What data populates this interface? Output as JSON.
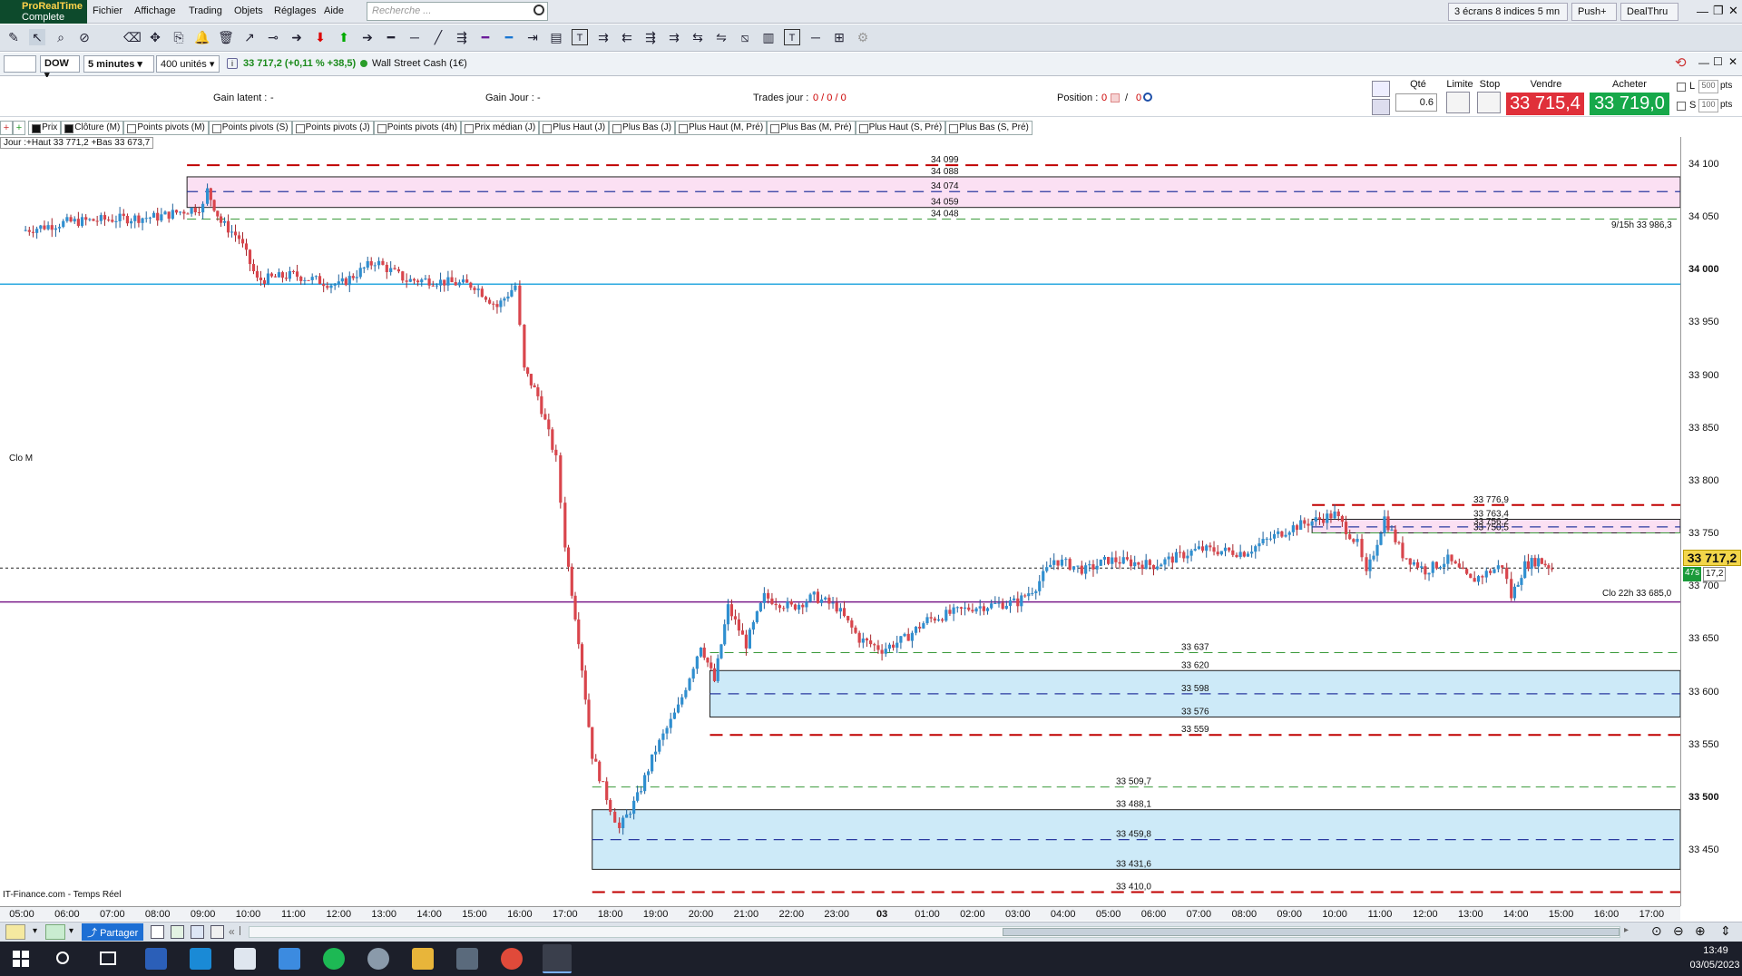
{
  "app": {
    "brand_line1": "ProRealTime",
    "brand_line2": "Complete"
  },
  "menu": [
    "Fichier",
    "Affichage",
    "Trading",
    "Objets",
    "Réglages",
    "Aide"
  ],
  "search": {
    "placeholder": "Recherche ..."
  },
  "topright": {
    "layout": "3 écrans 8 indices 5 mn",
    "push": "Push+",
    "dealthru": "DealThru"
  },
  "symbol": {
    "ticker": "DOW",
    "timeframe": "5 minutes",
    "units": "400 unités",
    "price_change": "33 717,2 (+0,11 % +38,5)",
    "name": "Wall Street Cash (1€)"
  },
  "info": {
    "gain_latent": "Gain latent :",
    "gain_latent_val": "-",
    "gain_jour": "Gain Jour :",
    "gain_jour_val": "-",
    "trades_jour": "Trades jour :",
    "trades_jour_val": "0 / 0 / 0",
    "position": "Position :",
    "position_val": "0",
    "position_val2": "0"
  },
  "order": {
    "qte_label": "Qté",
    "qte_value": "0.6",
    "limite": "Limite",
    "stop": "Stop",
    "vendre": "Vendre",
    "acheter": "Acheter",
    "sell_price": "33 715,4",
    "buy_price": "33 719,0",
    "l_label": "L",
    "l_val": "500",
    "s_label": "S",
    "s_val": "100",
    "pts": "pts"
  },
  "indicator_tabs": [
    "Prix",
    "Clôture (M)",
    "Points pivots (M)",
    "Points pivots (S)",
    "Points pivots (J)",
    "Points pivots (4h)",
    "Prix médian (J)",
    "Plus Haut (J)",
    "Plus Bas (J)",
    "Plus Haut (M, Pré)",
    "Plus Bas (M, Pré)",
    "Plus Haut (S, Pré)",
    "Plus Bas (S, Pré)"
  ],
  "jour_label": "Jour :+Haut 33 771,2 +Bas 33 673,7",
  "source_label": "IT-Finance.com - Temps Réel",
  "clo_m_label": "Clo M",
  "line_9_15": "9/15h 33 986,3",
  "line_clo22": "Clo 22h 33 685,0",
  "current_price": "33 717,2",
  "countdown": "47s",
  "spread_val": "17,2",
  "colors": {
    "bull": "#2f8fd0",
    "bear": "#d9454c",
    "red_dash": "#c00000",
    "green_dash": "#3a9a3a",
    "pink_zone": "#fbe0f3",
    "blue_zone": "#cdeaf8",
    "cyan": "#2aa8e0",
    "purple": "#7a1c8a"
  },
  "chart_data": {
    "type": "candlestick",
    "instrument": "DOW",
    "timeframe": "5 minutes",
    "xaxis_ticks": [
      "05:00",
      "06:00",
      "07:00",
      "08:00",
      "09:00",
      "10:00",
      "11:00",
      "12:00",
      "13:00",
      "14:00",
      "15:00",
      "16:00",
      "17:00",
      "18:00",
      "19:00",
      "20:00",
      "21:00",
      "22:00",
      "23:00",
      "03",
      "01:00",
      "02:00",
      "03:00",
      "04:00",
      "05:00",
      "06:00",
      "07:00",
      "08:00",
      "09:00",
      "10:00",
      "11:00",
      "12:00",
      "13:00",
      "14:00",
      "15:00",
      "16:00",
      "17:00"
    ],
    "yaxis_ticks": [
      "34 100",
      "34 050",
      "34 000",
      "33 950",
      "33 900",
      "33 850",
      "33 800",
      "33 750",
      "33 700",
      "33 650",
      "33 600",
      "33 550",
      "33 500",
      "33 450"
    ],
    "ylim": [
      33410,
      34110
    ],
    "price_path": [
      [
        0,
        34037
      ],
      [
        1,
        34045
      ],
      [
        2,
        34048
      ],
      [
        3,
        34050
      ],
      [
        4,
        34060
      ],
      [
        4.1,
        34075
      ],
      [
        4.4,
        34045
      ],
      [
        4.8,
        34030
      ],
      [
        5.2,
        33990
      ],
      [
        6,
        33995
      ],
      [
        7,
        33985
      ],
      [
        7.8,
        34008
      ],
      [
        8.5,
        33990
      ],
      [
        9,
        33990
      ],
      [
        10,
        33985
      ],
      [
        10.5,
        33965
      ],
      [
        10.9,
        33985
      ],
      [
        11.1,
        33905
      ],
      [
        11.4,
        33880
      ],
      [
        11.8,
        33820
      ],
      [
        12,
        33740
      ],
      [
        12.3,
        33650
      ],
      [
        12.6,
        33540
      ],
      [
        13,
        33490
      ],
      [
        13.2,
        33470
      ],
      [
        13.6,
        33500
      ],
      [
        14,
        33545
      ],
      [
        14.5,
        33585
      ],
      [
        15,
        33645
      ],
      [
        15.3,
        33610
      ],
      [
        15.6,
        33680
      ],
      [
        16,
        33645
      ],
      [
        16.4,
        33690
      ],
      [
        17,
        33680
      ],
      [
        17.5,
        33690
      ],
      [
        18,
        33680
      ],
      [
        18.5,
        33650
      ],
      [
        19,
        33640
      ],
      [
        19.5,
        33650
      ],
      [
        20,
        33668
      ],
      [
        21,
        33680
      ],
      [
        22,
        33685
      ],
      [
        22.4,
        33700
      ],
      [
        22.8,
        33725
      ],
      [
        23.5,
        33715
      ],
      [
        24,
        33725
      ],
      [
        25,
        33720
      ],
      [
        26,
        33735
      ],
      [
        27,
        33732
      ],
      [
        28,
        33755
      ],
      [
        29,
        33768
      ],
      [
        29.5,
        33740
      ],
      [
        29.7,
        33710
      ],
      [
        30.1,
        33765
      ],
      [
        30.5,
        33730
      ],
      [
        31,
        33715
      ],
      [
        31.5,
        33725
      ],
      [
        32,
        33705
      ],
      [
        32.7,
        33720
      ],
      [
        32.9,
        33690
      ],
      [
        33.2,
        33720
      ],
      [
        33.5,
        33725
      ],
      [
        33.8,
        33717.2
      ]
    ],
    "levels": [
      {
        "label": "34 099",
        "value": 34099,
        "style": "red-dash"
      },
      {
        "label": "34 088",
        "value": 34088,
        "style": "zone-top"
      },
      {
        "label": "34 074",
        "value": 34074,
        "style": "blue-dash"
      },
      {
        "label": "34 059",
        "value": 34059,
        "style": "zone-bottom"
      },
      {
        "label": "34 048",
        "value": 34048,
        "style": "green-dash"
      },
      {
        "label": "9/15h 33 986,3",
        "value": 33986.3,
        "style": "cyan"
      },
      {
        "label": "33 776,9",
        "value": 33776.9,
        "style": "red-dash"
      },
      {
        "label": "33 763,4",
        "value": 33763.4,
        "style": "zone-top"
      },
      {
        "label": "33 756,2",
        "value": 33756.2,
        "style": "blue-dash"
      },
      {
        "label": "33 750,5",
        "value": 33750.5,
        "style": "green-dash"
      },
      {
        "label": "Clo M",
        "value": 33717.2,
        "style": "black-dot"
      },
      {
        "label": "Clo 22h 33 685,0",
        "value": 33685.0,
        "style": "purple"
      },
      {
        "label": "33 637",
        "value": 33637,
        "style": "green-dash"
      },
      {
        "label": "33 620",
        "value": 33620,
        "style": "zone-top"
      },
      {
        "label": "33 598",
        "value": 33598,
        "style": "blue-dash"
      },
      {
        "label": "33 576",
        "value": 33576,
        "style": "zone-bottom"
      },
      {
        "label": "33 559",
        "value": 33559,
        "style": "red-dash"
      },
      {
        "label": "33 509,7",
        "value": 33509.7,
        "style": "green-dash"
      },
      {
        "label": "33 488,1",
        "value": 33488.1,
        "style": "zone-top"
      },
      {
        "label": "33 459,8",
        "value": 33459.8,
        "style": "blue-dash"
      },
      {
        "label": "33 431,6",
        "value": 33431.6,
        "style": "zone-bottom"
      },
      {
        "label": "33 410,0",
        "value": 33410.0,
        "style": "red-dash"
      }
    ]
  },
  "statusbar": {
    "share": "Partager"
  },
  "taskbar": {
    "time": "13:49",
    "date": "03/05/2023"
  }
}
